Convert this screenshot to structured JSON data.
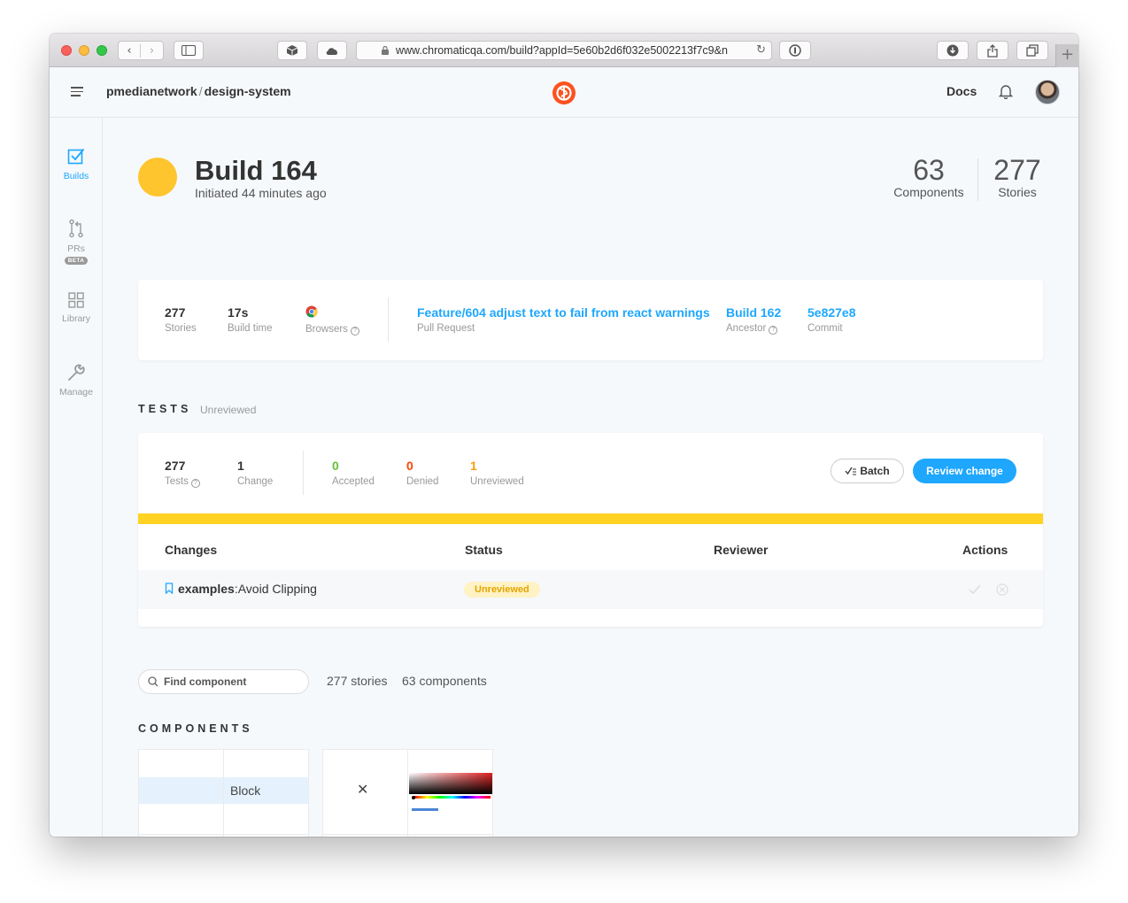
{
  "browser": {
    "url": "www.chromaticqa.com/build?appId=5e60b2d6f032e5002213f7c9&n"
  },
  "header": {
    "org": "pmedianetwork",
    "separator": "/",
    "repo": "design-system",
    "docs_label": "Docs"
  },
  "sidebar": {
    "items": [
      {
        "label": "Builds"
      },
      {
        "label": "PRs",
        "badge": "BETA"
      },
      {
        "label": "Library"
      },
      {
        "label": "Manage"
      }
    ]
  },
  "build": {
    "title": "Build 164",
    "subtitle": "Initiated 44 minutes ago",
    "status_color": "#ffc52e",
    "components_count": "63",
    "components_label": "Components",
    "stories_count": "277",
    "stories_label": "Stories"
  },
  "info": {
    "stories_value": "277",
    "stories_label": "Stories",
    "build_time_value": "17s",
    "build_time_label": "Build time",
    "browsers_label": "Browsers",
    "browsers_icon": "chrome-icon",
    "pr_title": "Feature/604 adjust text to fail from react warnings",
    "pr_label": "Pull Request",
    "ancestor_value": "Build 162",
    "ancestor_label": "Ancestor",
    "commit_value": "5e827e8",
    "commit_label": "Commit"
  },
  "tests": {
    "section_title": "TESTS",
    "section_status": "Unreviewed",
    "tests_value": "277",
    "tests_label": "Tests",
    "change_value": "1",
    "change_label": "Change",
    "accepted_value": "0",
    "accepted_label": "Accepted",
    "denied_value": "0",
    "denied_label": "Denied",
    "unreviewed_value": "1",
    "unreviewed_label": "Unreviewed",
    "batch_label": "Batch",
    "review_label": "Review change",
    "columns": [
      "Changes",
      "Status",
      "Reviewer",
      "Actions"
    ],
    "rows": [
      {
        "component": "examples",
        "sep": ":",
        "story": "Avoid Clipping",
        "status": "Unreviewed"
      }
    ]
  },
  "components": {
    "search_placeholder": "Find component",
    "stories_count": "277 stories",
    "components_count": "63 components",
    "section_title": "COMPONENTS",
    "card1_label": "Block",
    "card2_glyph": "✕"
  },
  "colors": {
    "accent": "#1ea7fd",
    "accepted": "#66bf3c",
    "denied": "#ff4400",
    "unreviewed": "#fc9c0d",
    "progress": "#ffd223",
    "logo": "#fc521f"
  }
}
